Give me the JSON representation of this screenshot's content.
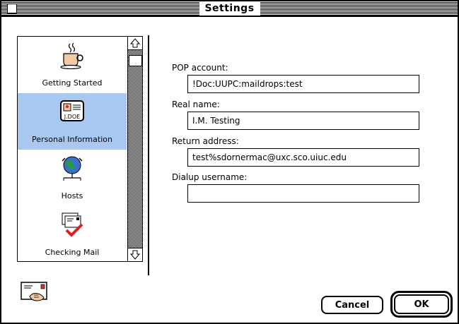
{
  "window": {
    "title": "Settings"
  },
  "sidebar": {
    "items": [
      {
        "label": "Getting Started",
        "icon": "coffee-cup-icon",
        "selected": false
      },
      {
        "label": "Personal Information",
        "icon": "id-card-icon",
        "card_text": "J.DOE",
        "selected": true
      },
      {
        "label": "Hosts",
        "icon": "globe-network-icon",
        "selected": false
      },
      {
        "label": "Checking Mail",
        "icon": "mail-check-icon",
        "selected": false
      }
    ]
  },
  "form": {
    "pop_account": {
      "label": "POP account:",
      "value": "!Doc:UUPC:maildrops:test"
    },
    "real_name": {
      "label": "Real name:",
      "value": "I.M. Testing"
    },
    "return_address": {
      "label": "Return address:",
      "value": "test%sdornermac@uxc.sco.uiuc.edu"
    },
    "dialup_username": {
      "label": "Dialup username:",
      "value": ""
    }
  },
  "buttons": {
    "cancel": "Cancel",
    "ok": "OK"
  },
  "colors": {
    "selection": "#a8c8f0",
    "check": "#e02020",
    "globe": "#2a9a4a"
  }
}
